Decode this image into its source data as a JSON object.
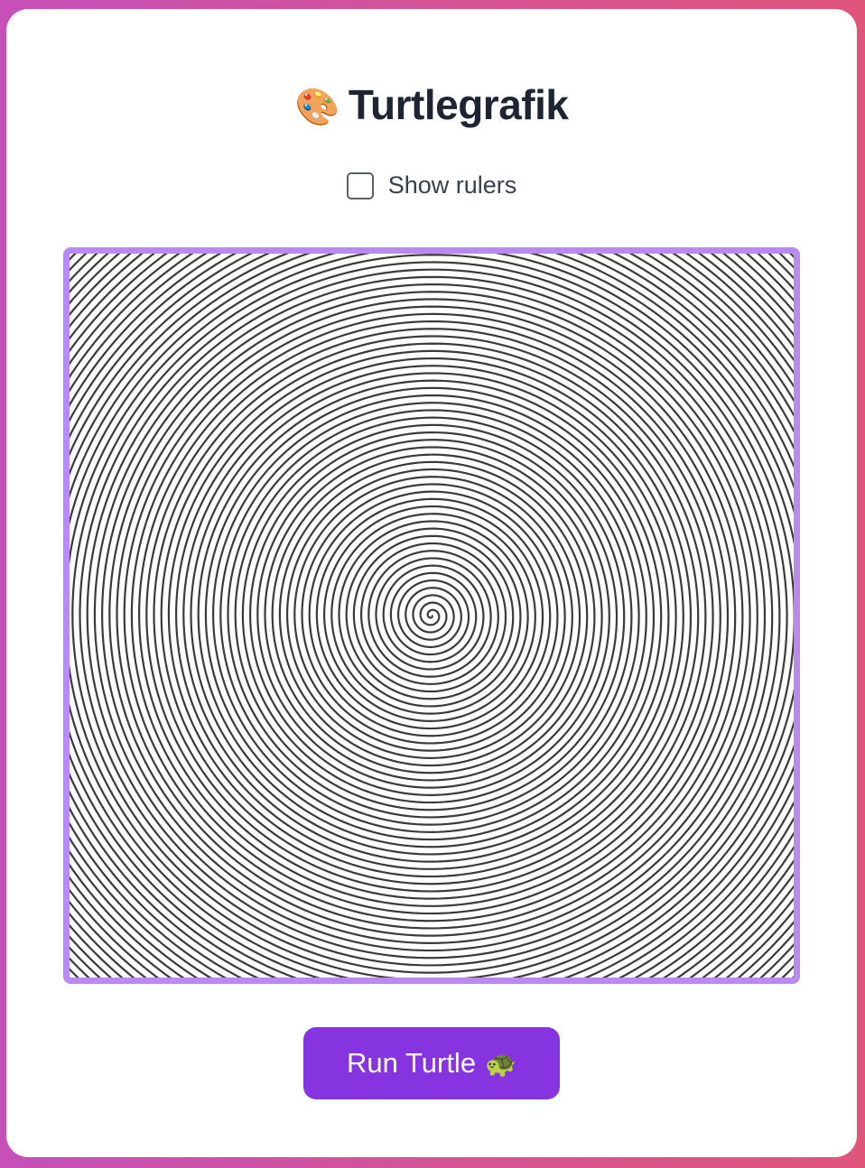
{
  "page": {
    "title": "Turtlegrafik",
    "title_icon": "🎨",
    "title_icon_name": "artist-palette-icon"
  },
  "controls": {
    "show_rulers_label": "Show rulers",
    "show_rulers_checked": false,
    "run_button_label": "Run Turtle",
    "run_button_icon": "🐢",
    "run_button_icon_name": "turtle-icon"
  },
  "canvas": {
    "drawing": "spiral",
    "stroke_color": "#3a3a3a",
    "frame_color": "#b98bf0",
    "background": "#ffffff"
  },
  "colors": {
    "accent": "#8634e0",
    "frame": "#b98bf0",
    "title_text": "#1f2433",
    "page_gradient_start": "#c650b8",
    "page_gradient_end": "#e0557c"
  }
}
